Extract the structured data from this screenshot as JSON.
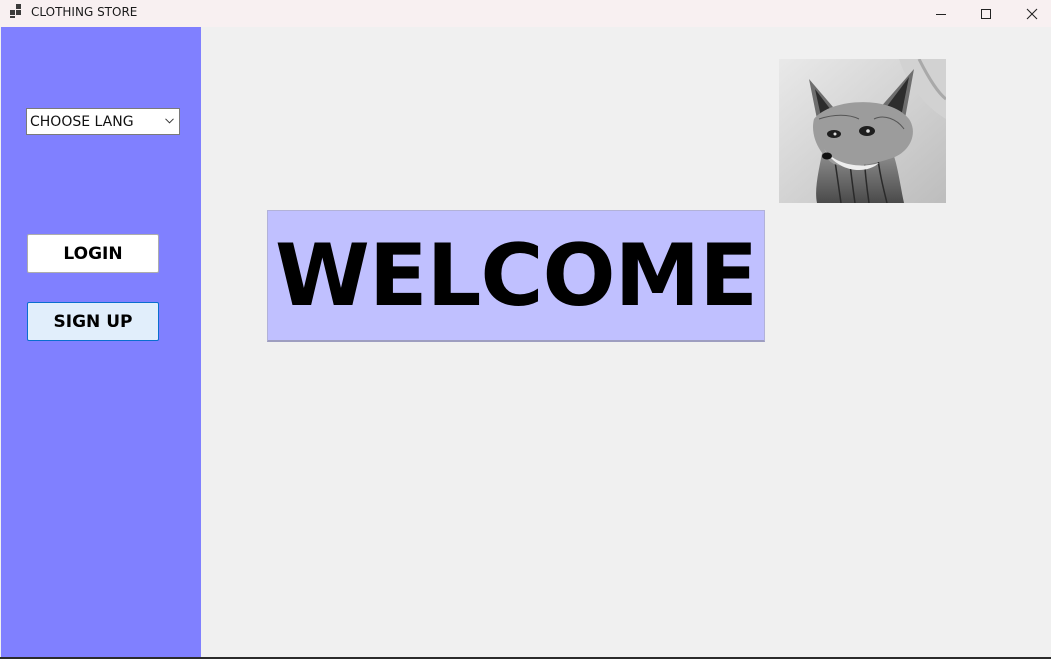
{
  "window": {
    "title": "CLOTHING STORE",
    "icons": [
      "app-icon",
      "minimize-icon",
      "maximize-icon",
      "close-icon"
    ]
  },
  "sidebar": {
    "background": "#8080ff",
    "language_select": {
      "value": "CHOOSE LANG"
    },
    "login_label": "LOGIN",
    "signup_label": "SIGN UP"
  },
  "main": {
    "welcome_text": "WELCOME",
    "welcome_background": "#c0c0ff",
    "picture": "fox-image"
  }
}
